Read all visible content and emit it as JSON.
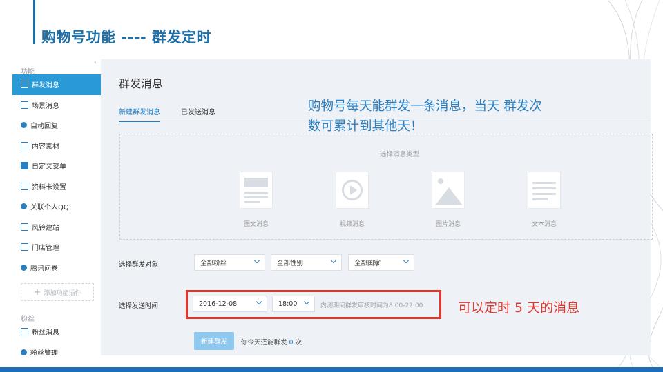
{
  "slide": {
    "title": "购物号功能 ---- 群发定时"
  },
  "sidebar": {
    "group_function": "功能",
    "items": [
      {
        "label": "群发消息",
        "icon": "broadcast-icon",
        "active": true
      },
      {
        "label": "场景消息",
        "icon": "scene-icon"
      },
      {
        "label": "自动回复",
        "icon": "auto-reply-icon"
      },
      {
        "label": "内容素材",
        "icon": "content-icon"
      },
      {
        "label": "自定义菜单",
        "icon": "menu-icon"
      },
      {
        "label": "资料卡设置",
        "icon": "profile-card-icon"
      },
      {
        "label": "关联个人QQ",
        "icon": "link-icon"
      },
      {
        "label": "风铃建站",
        "icon": "site-icon"
      },
      {
        "label": "门店管理",
        "icon": "store-icon"
      },
      {
        "label": "腾讯问卷",
        "icon": "survey-icon"
      }
    ],
    "add_plugin": "添加功能插件",
    "group_fans": "粉丝",
    "fan_items": [
      {
        "label": "粉丝消息",
        "icon": "fan-message-icon"
      },
      {
        "label": "粉丝管理",
        "icon": "fan-manage-icon"
      }
    ]
  },
  "main": {
    "title": "群发消息",
    "tabs": [
      {
        "label": "新建群发消息",
        "active": true
      },
      {
        "label": "已发送消息",
        "active": false
      }
    ],
    "type_caption": "选择消息类型",
    "types": [
      {
        "label": "图文消息",
        "icon": "article-icon"
      },
      {
        "label": "视频消息",
        "icon": "video-icon"
      },
      {
        "label": "图片消息",
        "icon": "image-icon"
      },
      {
        "label": "文本消息",
        "icon": "text-icon"
      }
    ],
    "target_label": "选择群发对象",
    "target_selects": [
      "全部粉丝",
      "全部性别",
      "全部国家"
    ],
    "time_label": "选择发送时间",
    "date_value": "2016-12-08",
    "time_value": "18:00",
    "time_hint": "内测期间群发审核时间为8:00-22:00",
    "create_button": "新建群发",
    "remaining_prefix": "你今天还能群发",
    "remaining_count": "0",
    "remaining_suffix": "次"
  },
  "annotations": {
    "blue": "购物号每天能群发一条消息，当天 群发次数可累计到其他天！",
    "red": "可以定时 5 天的消息"
  },
  "colors": {
    "accent": "#2a9ad6",
    "title": "#1d6fa8",
    "highlight": "#e0362c"
  }
}
